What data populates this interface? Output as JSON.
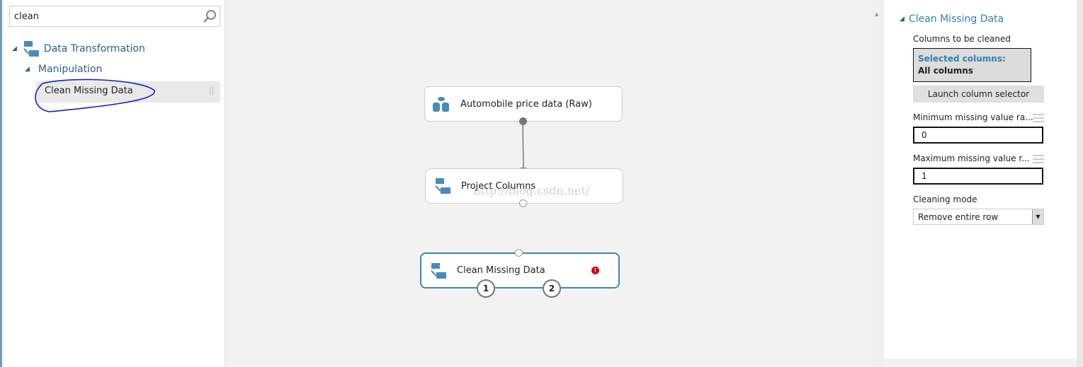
{
  "palette": {
    "search": {
      "value": "clean"
    },
    "tree": {
      "category": "Data Transformation",
      "subcategory": "Manipulation",
      "item": "Clean Missing Data"
    }
  },
  "canvas": {
    "nodes": [
      {
        "label": "Automobile price data (Raw)",
        "icon": "dataset-icon"
      },
      {
        "label": "Project Columns",
        "icon": "transform-icon"
      },
      {
        "label": "Clean Missing Data",
        "icon": "transform-icon",
        "status": "error",
        "ports": [
          "1",
          "2"
        ]
      }
    ],
    "watermark": "http://blog.csdn.net/"
  },
  "properties": {
    "title": "Clean Missing Data",
    "columns_label": "Columns to be cleaned",
    "selected_heading": "Selected columns:",
    "selected_value": "All columns",
    "launch_button": "Launch column selector",
    "min_label": "Minimum missing value ra...",
    "min_value": "0",
    "max_label": "Maximum missing value r...",
    "max_value": "1",
    "mode_label": "Cleaning mode",
    "mode_value": "Remove entire row"
  },
  "colors": {
    "accent": "#2f7fb0",
    "error": "#d40000"
  }
}
